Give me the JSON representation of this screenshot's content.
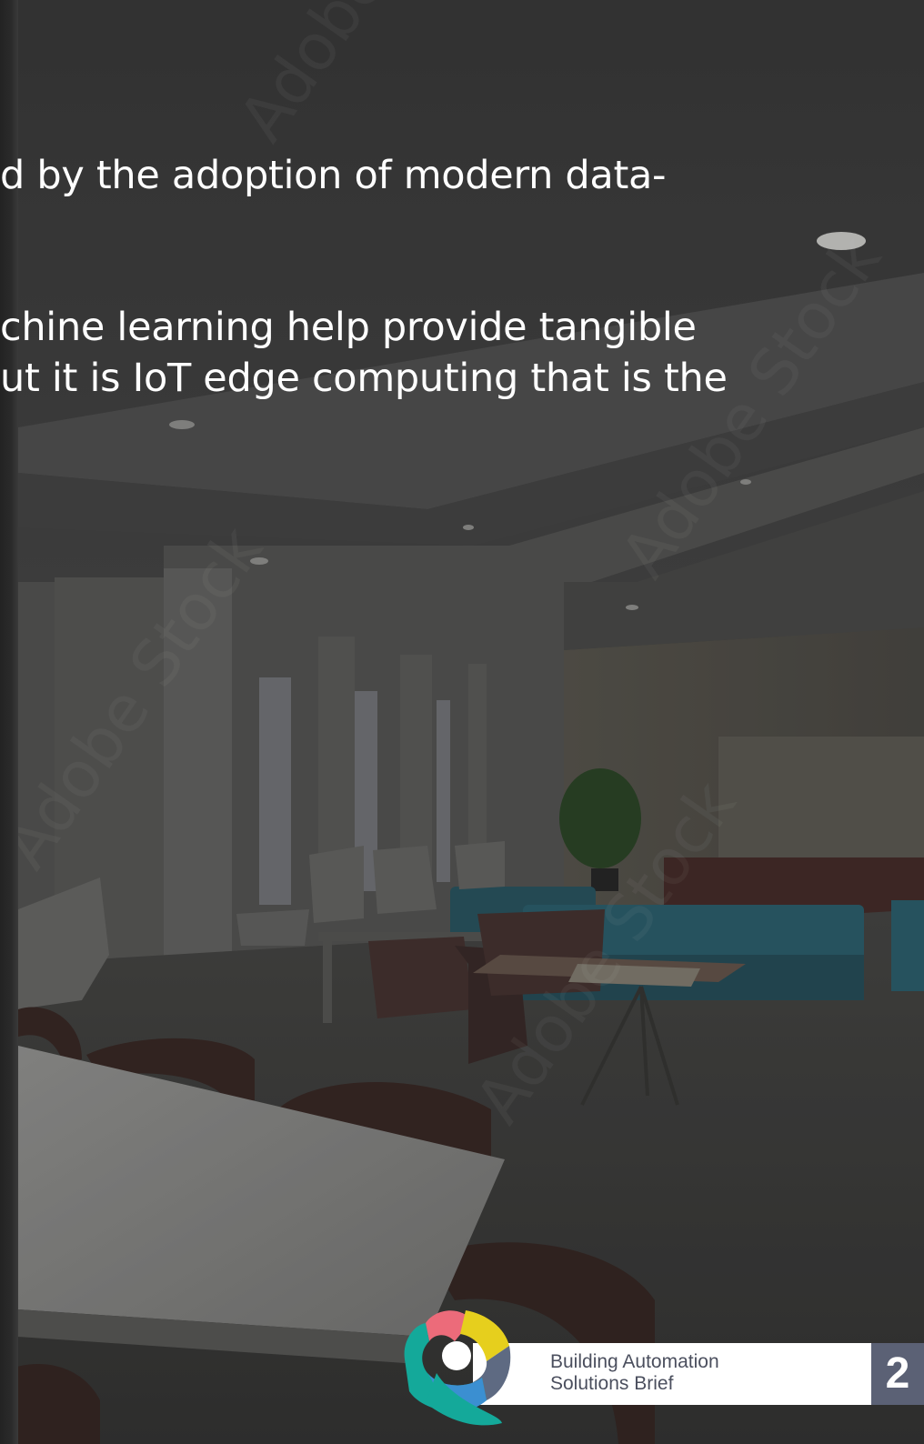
{
  "body_text": {
    "line_1": "d by the adoption of modern data-",
    "line_2": "chine learning help provide tangible",
    "line_3": "ut it is IoT edge computing that is the"
  },
  "footer": {
    "title_line_1": "Building Automation",
    "title_line_2": "Solutions Brief",
    "page_number": "2"
  },
  "watermark": "Adobe Stock",
  "colors": {
    "footer_bar": "#ffffff",
    "page_number_bg": "#5b6175",
    "footer_text": "#4b4f5e",
    "logo_teal": "#14a99a",
    "logo_yellow": "#e6cf1d",
    "logo_pink": "#ec6b7a",
    "logo_blue": "#3b8fd1",
    "logo_slate": "#5e6a82"
  }
}
